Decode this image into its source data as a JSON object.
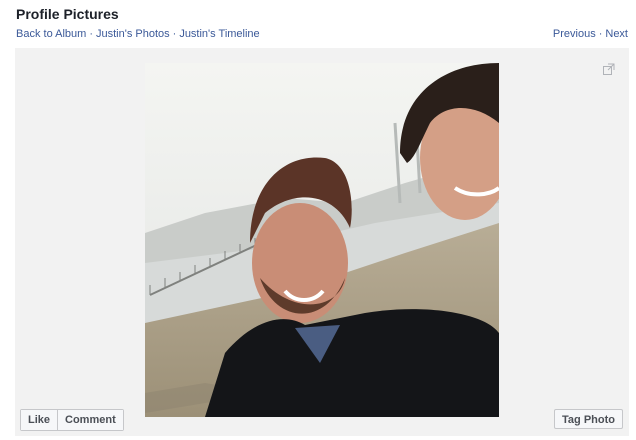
{
  "header": {
    "title": "Profile Pictures"
  },
  "breadcrumbs": {
    "back_to_album": "Back to Album",
    "separator": "·",
    "photos_link": "Justin's Photos",
    "timeline_link": "Justin's Timeline"
  },
  "pager": {
    "previous": "Previous",
    "separator": "·",
    "next": "Next"
  },
  "photo": {
    "icon": "expand-icon"
  },
  "actions": {
    "like": "Like",
    "comment": "Comment",
    "tag_photo": "Tag Photo"
  },
  "colors": {
    "link": "#3b5998",
    "title": "#1d2129",
    "stage_bg": "#f2f2f2"
  }
}
